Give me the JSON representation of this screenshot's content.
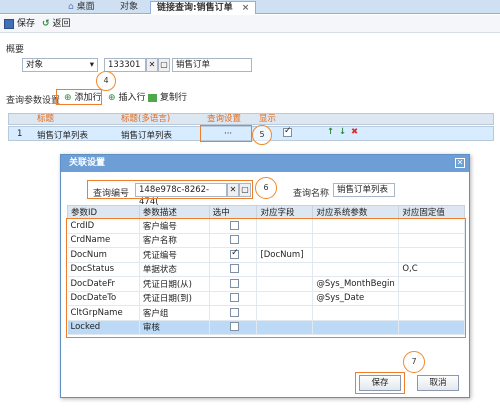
{
  "tabs": [
    {
      "label": "桌面",
      "icon": "home-icon"
    },
    {
      "label": "对象"
    },
    {
      "label": "链接查询:销售订单",
      "close": "×"
    }
  ],
  "toolbar": {
    "save": "保存",
    "back": "返回"
  },
  "summary": {
    "label": "概要",
    "type_value": "对象",
    "code_value": "133301",
    "name_value": "销售订单"
  },
  "params_section": {
    "label": "查询参数设置",
    "add_row": "添加行",
    "insert_row": "插入行",
    "copy_row": "复制行"
  },
  "main_grid": {
    "headers": [
      "标题",
      "标题(多语言)",
      "查询设置",
      "显示"
    ],
    "row": {
      "index": "1",
      "title": "销售订单列表",
      "title_ml": "销售订单列表",
      "setting": "···",
      "shown": true
    }
  },
  "dialog": {
    "title": "关联设置",
    "query_code_label": "查询编号",
    "query_code_value": "148e978c-8262-474(",
    "query_name_label": "查询名称",
    "query_name_value": "销售订单列表",
    "columns": [
      "参数ID",
      "参数描述",
      "选中",
      "对应字段",
      "对应系统参数",
      "对应固定值"
    ],
    "rows": [
      {
        "id": "CrdID",
        "desc": "客户编号",
        "checked": false,
        "field": "",
        "sys": "",
        "fixed": ""
      },
      {
        "id": "CrdName",
        "desc": "客户名称",
        "checked": false,
        "field": "",
        "sys": "",
        "fixed": ""
      },
      {
        "id": "DocNum",
        "desc": "凭证编号",
        "checked": true,
        "field": "[DocNum]",
        "sys": "",
        "fixed": ""
      },
      {
        "id": "DocStatus",
        "desc": "单据状态",
        "checked": false,
        "field": "",
        "sys": "",
        "fixed": "O,C"
      },
      {
        "id": "DocDateFr",
        "desc": "凭证日期(从)",
        "checked": false,
        "field": "",
        "sys": "@Sys_MonthBegin",
        "fixed": ""
      },
      {
        "id": "DocDateTo",
        "desc": "凭证日期(到)",
        "checked": false,
        "field": "",
        "sys": "@Sys_Date",
        "fixed": ""
      },
      {
        "id": "CltGrpName",
        "desc": "客户组",
        "checked": false,
        "field": "",
        "sys": "",
        "fixed": ""
      },
      {
        "id": "Locked",
        "desc": "审核",
        "checked": false,
        "field": "",
        "sys": "",
        "fixed": ""
      }
    ],
    "save": "保存",
    "cancel": "取消"
  },
  "callouts": [
    "4",
    "5",
    "6",
    "7"
  ],
  "colors": {
    "accent": "#f08a2b",
    "header_text": "#e26b1b",
    "dialog_title": "#6d9fd6"
  }
}
